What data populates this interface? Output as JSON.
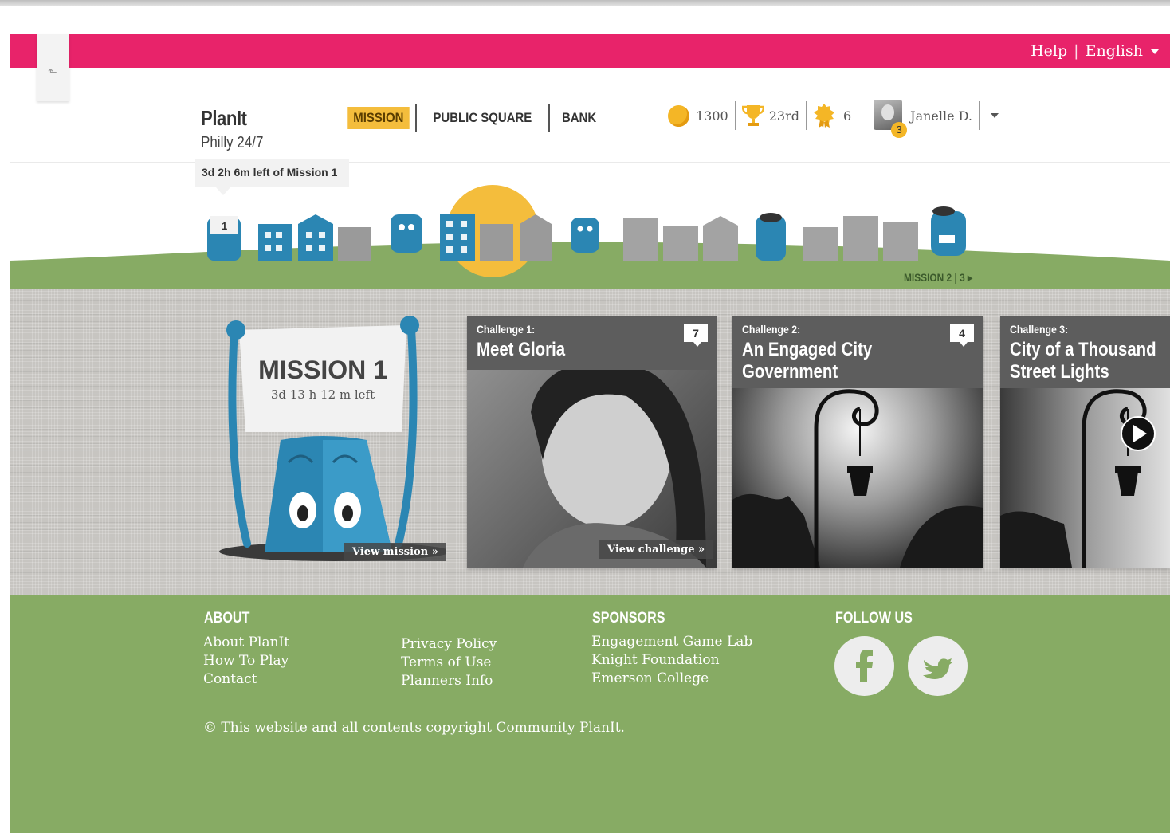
{
  "topbar": {
    "help": "Help",
    "separator": "|",
    "language": "English"
  },
  "brand": {
    "title": "PlanIt",
    "subtitle": "Philly 24/7"
  },
  "nav": {
    "items": [
      "MISSION",
      "PUBLIC SQUARE",
      "BANK"
    ],
    "active": "MISSION"
  },
  "stats": {
    "coins": "1300",
    "rank": "23rd",
    "awards": "6",
    "user": "Janelle D.",
    "user_level": "3"
  },
  "mission_tooltip": "3d 2h 6m left of Mission 1",
  "scene": {
    "marker": "1"
  },
  "mission_nav": "MISSION 2 | 3",
  "mission_card": {
    "title": "MISSION 1",
    "time_left": "3d 13 h 12 m left",
    "view": "View mission »"
  },
  "challenges": [
    {
      "label": "Challenge 1:",
      "title": "Meet Gloria",
      "count": "7",
      "view": "View challenge »"
    },
    {
      "label": "Challenge 2:",
      "title": "An Engaged City Government",
      "count": "4"
    },
    {
      "label": "Challenge 3:",
      "title": "City of a Thousand Street Lights"
    }
  ],
  "footer": {
    "about_heading": "ABOUT",
    "about_links": [
      "About PlanIt",
      "How To Play",
      "Contact"
    ],
    "legal_links": [
      "Privacy Policy",
      "Terms of Use",
      "Planners Info"
    ],
    "sponsors_heading": "SPONSORS",
    "sponsors": [
      "Engagement Game Lab",
      "Knight Foundation",
      "Emerson College"
    ],
    "follow_heading": "FOLLOW US",
    "copyright": "© This website and all contents copyright Community PlanIt."
  },
  "colors": {
    "pink": "#e8236a",
    "green": "#87ab64",
    "blue": "#2b86b3",
    "gold": "#f4bd3c"
  },
  "icons": [
    "back-arrow-icon",
    "coin-icon",
    "trophy-icon",
    "award-icon",
    "facebook-icon",
    "twitter-icon",
    "play-icon"
  ]
}
